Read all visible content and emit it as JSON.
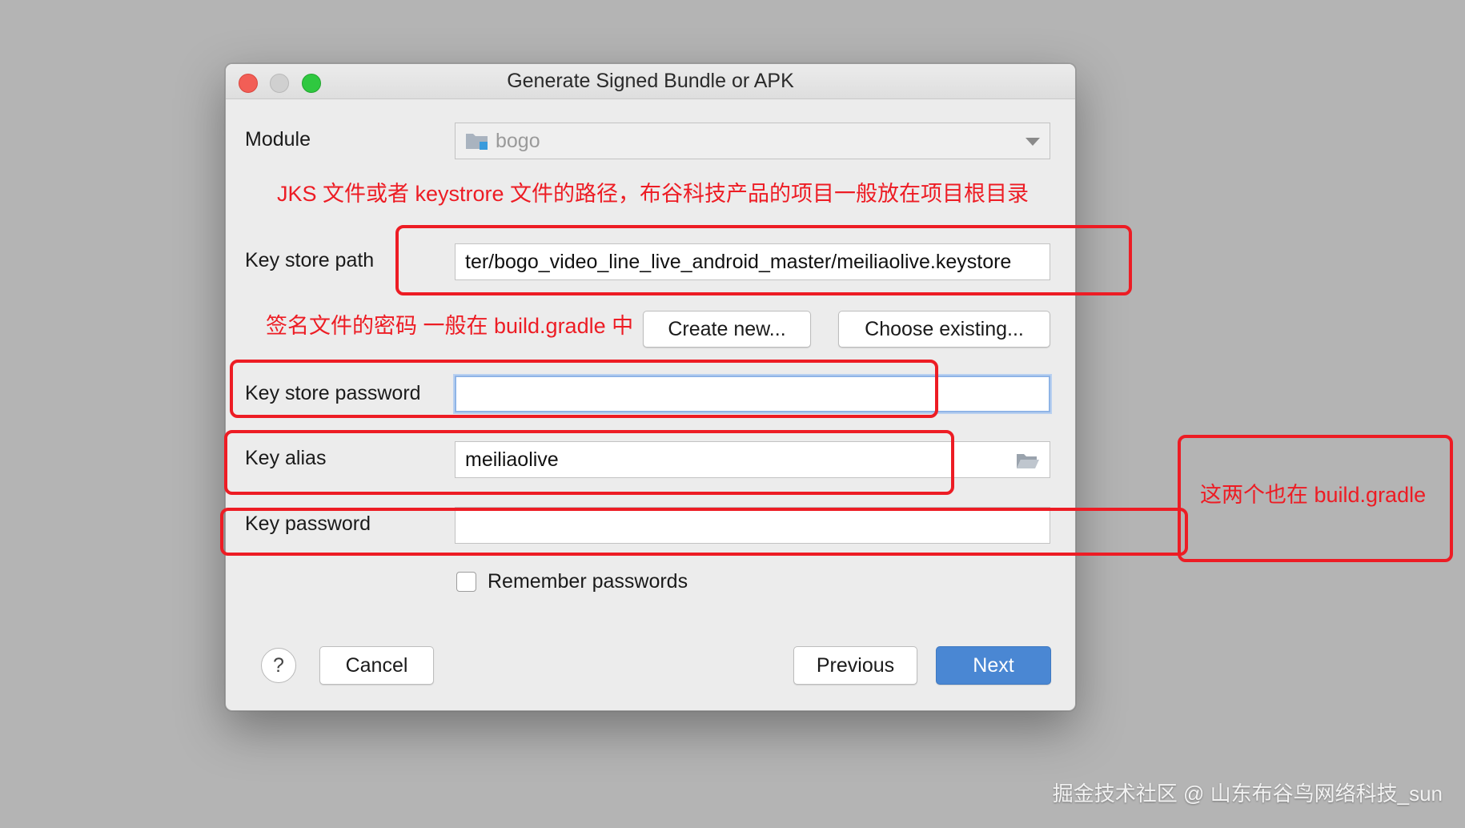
{
  "window": {
    "title": "Generate Signed Bundle or APK"
  },
  "form": {
    "module_label": "Module",
    "module_value": "bogo",
    "keystore_path_label": "Key store path",
    "keystore_path_value": "ter/bogo_video_line_live_android_master/meiliaolive.keystore",
    "create_new_label": "Create new...",
    "choose_existing_label": "Choose existing...",
    "keystore_password_label": "Key store password",
    "keystore_password_value": "",
    "key_alias_label": "Key alias",
    "key_alias_value": "meiliaolive",
    "key_password_label": "Key password",
    "key_password_value": "",
    "remember_label": "Remember passwords",
    "remember_checked": false
  },
  "footer": {
    "help_label": "?",
    "cancel_label": "Cancel",
    "previous_label": "Previous",
    "next_label": "Next"
  },
  "annotations": {
    "keystore_note": "JKS 文件或者 keystrore 文件的路径，布谷科技产品的项目一般放在项目根目录",
    "password_note": "签名文件的密码 一般在 build.gradle 中",
    "alias_note": "这两个也在 build.gradle",
    "color": "#ed1c24"
  },
  "watermark": "掘金技术社区 @ 山东布谷鸟网络科技_sun"
}
